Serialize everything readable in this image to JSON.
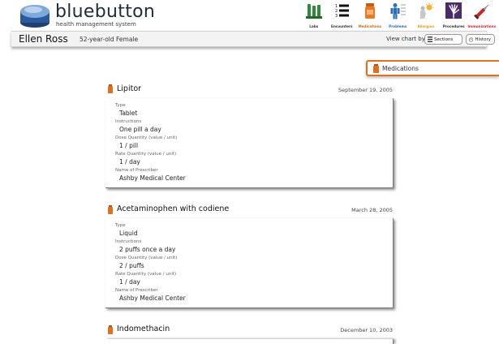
{
  "brand": {
    "name": "bluebutton",
    "subtitle": "health management system"
  },
  "nav": [
    {
      "label": "Labs",
      "icon": "flask-icon"
    },
    {
      "label": "Encounters",
      "icon": "list-icon"
    },
    {
      "label": "Medications",
      "icon": "pill-bottle-icon"
    },
    {
      "label": "Problems",
      "icon": "body-chart-icon"
    },
    {
      "label": "Allergies",
      "icon": "allergy-icon"
    },
    {
      "label": "Procedures",
      "icon": "xray-icon"
    },
    {
      "label": "Immunizations",
      "icon": "syringe-icon"
    }
  ],
  "patient": {
    "name": "Ellen Ross",
    "info": "52-year-old Female"
  },
  "view_chart": {
    "label": "View chart by:",
    "sections": "Sections",
    "history": "History"
  },
  "section": {
    "title": "Medications",
    "accent": "#e07020"
  },
  "field_labels": {
    "type": "Type",
    "instructions": "Instructions",
    "dose": "Dose Quantity (value / unit)",
    "rate": "Rate Quantity (value / unit)",
    "prescriber": "Name of Prescriber"
  },
  "medications": [
    {
      "name": "Lipitor",
      "date": "September 19, 2005",
      "type": "Tablet",
      "instructions": "One pill a day",
      "dose": "1 / pill",
      "rate": "1 / day",
      "prescriber": "Ashby Medical Center"
    },
    {
      "name": "Acetaminophen with codiene",
      "date": "March 28, 2005",
      "type": "Liquid",
      "instructions": "2 puffs once a day",
      "dose": "2 / puffs",
      "rate": "1 / day",
      "prescriber": "Ashby Medical Center"
    },
    {
      "name": "Indomethacin",
      "date": "December 10, 2003"
    }
  ]
}
